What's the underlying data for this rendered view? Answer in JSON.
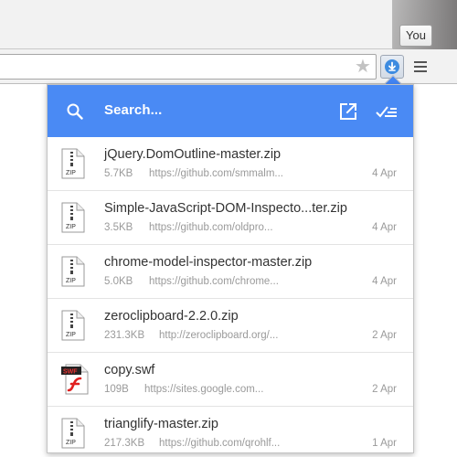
{
  "browser": {
    "profile_label": "You",
    "accent": "#4a8af4"
  },
  "popup": {
    "search_placeholder": "Search...",
    "icons": {
      "search": "search-icon",
      "open_folder": "open-downloads-folder-icon",
      "clear": "clear-all-icon"
    },
    "downloads": [
      {
        "name": "jQuery.DomOutline-master.zip",
        "size": "5.7KB",
        "url": "https://github.com/smmalm...",
        "date": "4 Apr",
        "type": "zip"
      },
      {
        "name": "Simple-JavaScript-DOM-Inspecto...ter.zip",
        "size": "3.5KB",
        "url": "https://github.com/oldpro...",
        "date": "4 Apr",
        "type": "zip"
      },
      {
        "name": "chrome-model-inspector-master.zip",
        "size": "5.0KB",
        "url": "https://github.com/chrome...",
        "date": "4 Apr",
        "type": "zip"
      },
      {
        "name": "zeroclipboard-2.2.0.zip",
        "size": "231.3KB",
        "url": "http://zeroclipboard.org/...",
        "date": "2 Apr",
        "type": "zip"
      },
      {
        "name": "copy.swf",
        "size": "109B",
        "url": "https://sites.google.com...",
        "date": "2 Apr",
        "type": "swf"
      },
      {
        "name": "trianglify-master.zip",
        "size": "217.3KB",
        "url": "https://github.com/qrohlf...",
        "date": "1 Apr",
        "type": "zip"
      }
    ]
  }
}
